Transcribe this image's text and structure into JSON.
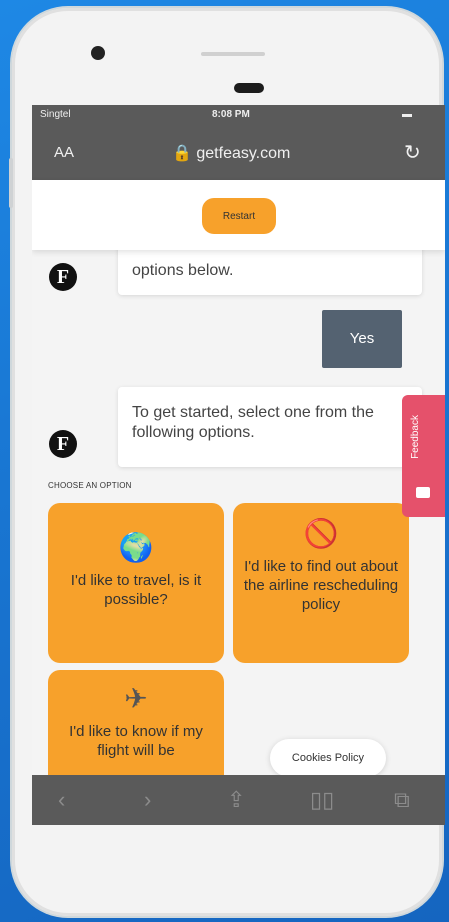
{
  "status_bar": {
    "carrier": "Singtel",
    "time": "8:08 PM",
    "battery": "▬"
  },
  "browser": {
    "text_size": "AA",
    "url": "getfeasy.com",
    "lock_icon": "lock-icon",
    "reload_icon": "reload-icon"
  },
  "header": {
    "restart_label": "Restart"
  },
  "avatar": {
    "letter": "F"
  },
  "messages": {
    "bot_1": "options below.",
    "user_1": "Yes",
    "bot_2": "To get started, select one from the following options."
  },
  "options_label": "CHOOSE AN OPTION",
  "options": [
    {
      "emoji": "🌍",
      "label": "I'd like to travel, is it possible?"
    },
    {
      "emoji": "🚫",
      "label": "I'd like to find out about the airline rescheduling policy"
    },
    {
      "emoji": "✈",
      "label": "I'd like to know if my flight will be"
    }
  ],
  "feedback_label": "Feedback",
  "cookies_label": "Cookies Policy",
  "toolbar": {
    "back": "‹",
    "forward": "›",
    "share": "⇪",
    "bookmarks": "▯▯",
    "tabs": "⧉"
  },
  "colors": {
    "accent": "#f7a12b",
    "user_bubble": "#546271",
    "feedback": "#e5516b",
    "browser_chrome": "#5a5a5a"
  }
}
